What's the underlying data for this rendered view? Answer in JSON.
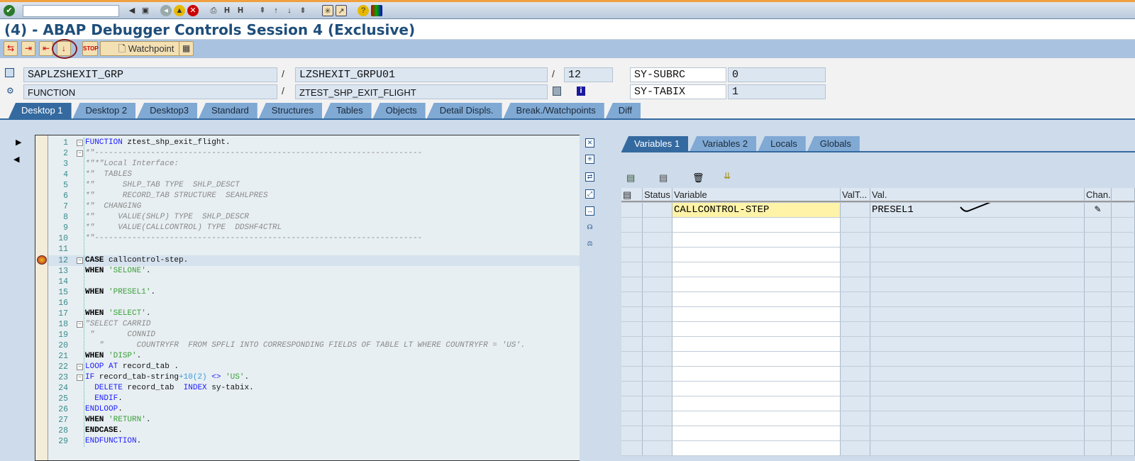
{
  "system_toolbar": {
    "command_field": "",
    "icons": [
      "enter-icon",
      "back-icon",
      "save-icon",
      "back-nav-icon",
      "exit-icon",
      "cancel-icon",
      "print-icon",
      "find-icon",
      "find-next-icon",
      "first-page-icon",
      "prev-page-icon",
      "next-page-icon",
      "last-page-icon",
      "new-session-icon",
      "shortcut-icon",
      "help-icon",
      "customize-icon"
    ]
  },
  "title": "(4) - ABAP Debugger Controls Session 4 (Exclusive)",
  "app_toolbar": {
    "buttons": [
      "single-step",
      "execute",
      "return",
      "continue-to-cursor",
      "stop"
    ],
    "watchpoint_label": "Watchpoint"
  },
  "info": {
    "program": "SAPLZSHEXIT_GRP",
    "include": "LZSHEXIT_GRPU01",
    "line": "12",
    "event_type": "FUNCTION",
    "event": "ZTEST_SHP_EXIT_FLIGHT",
    "sy_fields": [
      {
        "name": "SY-SUBRC",
        "value": "0"
      },
      {
        "name": "SY-TABIX",
        "value": "1"
      }
    ]
  },
  "main_tabs": [
    "Desktop 1",
    "Desktop 2",
    "Desktop3",
    "Standard",
    "Structures",
    "Tables",
    "Objects",
    "Detail Displs.",
    "Break./Watchpoints",
    "Diff"
  ],
  "code": [
    {
      "n": "1",
      "f": "-",
      "t": [
        [
          "kw",
          "FUNCTION"
        ],
        [
          "tx",
          " ztest_shp_exit_flight."
        ]
      ]
    },
    {
      "n": "2",
      "f": "-",
      "t": [
        [
          "cm",
          "*\"----------------------------------------------------------------------"
        ]
      ]
    },
    {
      "n": "3",
      "t": [
        [
          "cm",
          "*\"*\"Local Interface:"
        ]
      ]
    },
    {
      "n": "4",
      "t": [
        [
          "cm",
          "*\"  TABLES"
        ]
      ]
    },
    {
      "n": "5",
      "t": [
        [
          "cm",
          "*\"      SHLP_TAB TYPE  SHLP_DESCT"
        ]
      ]
    },
    {
      "n": "6",
      "t": [
        [
          "cm",
          "*\"      RECORD_TAB STRUCTURE  SEAHLPRES"
        ]
      ]
    },
    {
      "n": "7",
      "t": [
        [
          "cm",
          "*\"  CHANGING"
        ]
      ]
    },
    {
      "n": "8",
      "t": [
        [
          "cm",
          "*\"     VALUE(SHLP) TYPE  SHLP_DESCR"
        ]
      ]
    },
    {
      "n": "9",
      "t": [
        [
          "cm",
          "*\"     VALUE(CALLCONTROL) TYPE  DDSHF4CTRL"
        ]
      ]
    },
    {
      "n": "10",
      "t": [
        [
          "cm",
          "*\"----------------------------------------------------------------------"
        ]
      ]
    },
    {
      "n": "11",
      "t": []
    },
    {
      "n": "12",
      "f": "-",
      "cur": true,
      "t": [
        [
          "kb",
          "CASE"
        ],
        [
          "tx",
          " callcontrol-step."
        ]
      ]
    },
    {
      "n": "13",
      "t": [
        [
          "kb",
          "WHEN"
        ],
        [
          "tx",
          " "
        ],
        [
          "st",
          "'SELONE'"
        ],
        [
          "tx",
          "."
        ]
      ]
    },
    {
      "n": "14",
      "t": []
    },
    {
      "n": "15",
      "t": [
        [
          "kb",
          "WHEN"
        ],
        [
          "tx",
          " "
        ],
        [
          "st",
          "'PRESEL1'"
        ],
        [
          "tx",
          "."
        ]
      ]
    },
    {
      "n": "16",
      "t": []
    },
    {
      "n": "17",
      "t": [
        [
          "kb",
          "WHEN"
        ],
        [
          "tx",
          " "
        ],
        [
          "st",
          "'SELECT'"
        ],
        [
          "tx",
          "."
        ]
      ]
    },
    {
      "n": "18",
      "f": "-",
      "t": [
        [
          "cm",
          "\"SELECT CARRID"
        ]
      ]
    },
    {
      "n": "19",
      "t": [
        [
          "cm",
          " \"       CONNID"
        ]
      ]
    },
    {
      "n": "20",
      "t": [
        [
          "cm",
          "   \"       COUNTRYFR  FROM SPFLI INTO CORRESPONDING FIELDS OF TABLE LT WHERE COUNTRYFR = 'US'."
        ]
      ]
    },
    {
      "n": "21",
      "t": [
        [
          "kb",
          "WHEN"
        ],
        [
          "tx",
          " "
        ],
        [
          "st",
          "'DISP'"
        ],
        [
          "tx",
          "."
        ]
      ]
    },
    {
      "n": "22",
      "f": "-",
      "t": [
        [
          "kw",
          "LOOP AT"
        ],
        [
          "tx",
          " record_tab ."
        ]
      ]
    },
    {
      "n": "23",
      "f": "-",
      "t": [
        [
          "kw",
          "IF"
        ],
        [
          "tx",
          " record_tab-string"
        ],
        [
          "nm",
          "+10(2)"
        ],
        [
          "tx",
          " "
        ],
        [
          "kw",
          "<>"
        ],
        [
          "tx",
          " "
        ],
        [
          "st",
          "'US'"
        ],
        [
          "tx",
          "."
        ]
      ]
    },
    {
      "n": "24",
      "t": [
        [
          "tx",
          "  "
        ],
        [
          "kw",
          "DELETE"
        ],
        [
          "tx",
          " record_tab  "
        ],
        [
          "kw",
          "INDEX"
        ],
        [
          "tx",
          " sy-tabix."
        ]
      ]
    },
    {
      "n": "25",
      "t": [
        [
          "tx",
          "  "
        ],
        [
          "kw",
          "ENDIF"
        ],
        [
          "tx",
          "."
        ]
      ]
    },
    {
      "n": "26",
      "t": [
        [
          "kw",
          "ENDLOOP"
        ],
        [
          "tx",
          "."
        ]
      ]
    },
    {
      "n": "27",
      "t": [
        [
          "kb",
          "WHEN"
        ],
        [
          "tx",
          " "
        ],
        [
          "st",
          "'RETURN'"
        ],
        [
          "tx",
          "."
        ]
      ]
    },
    {
      "n": "28",
      "t": [
        [
          "kb",
          "ENDCASE"
        ],
        [
          "tx",
          "."
        ]
      ]
    },
    {
      "n": "29",
      "t": [
        [
          "kw",
          "ENDFUNCTION"
        ],
        [
          "tx",
          "."
        ]
      ]
    }
  ],
  "var_tabs": [
    "Variables 1",
    "Variables 2",
    "Locals",
    "Globals"
  ],
  "grid": {
    "headers": [
      "Status",
      "Variable",
      "ValT...",
      "Val.",
      "Chan..."
    ],
    "rows": [
      {
        "status": "",
        "variable": "CALLCONTROL-STEP",
        "valtype": "",
        "value": "PRESEL1"
      }
    ],
    "empty_rows": 16
  }
}
